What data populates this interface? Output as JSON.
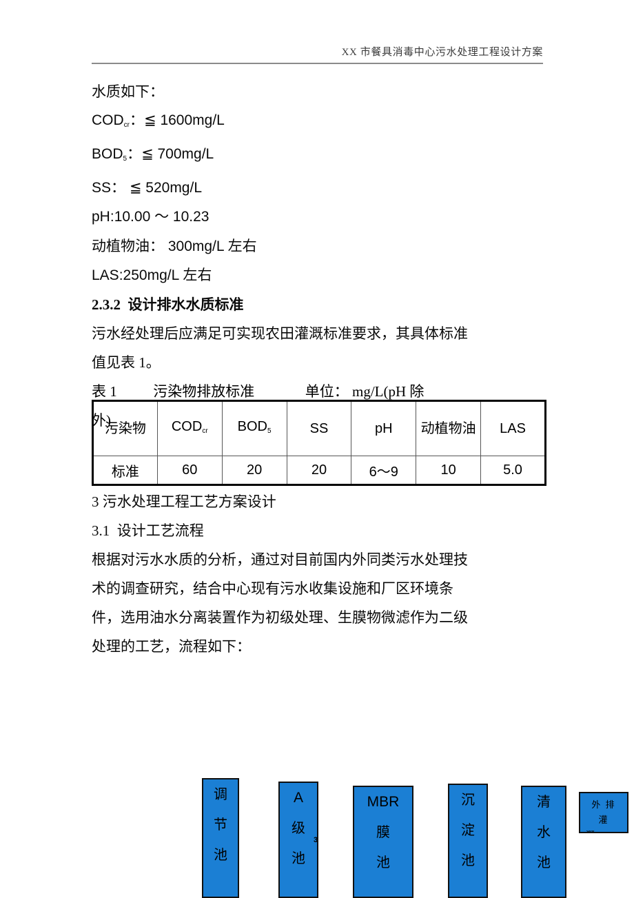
{
  "header": {
    "title": "XX 市餐具消毒中心污水处理工程设计方案"
  },
  "body": {
    "intro_label": "水质如下：",
    "quality": [
      {
        "prefix": "COD",
        "sub": "cr",
        "value": "：≦ 1600mg/L"
      },
      {
        "prefix": "BOD",
        "sub": "5",
        "value": "：≦ 700mg/L"
      },
      {
        "prefix": "SS",
        "sub": "",
        "value": "： ≦ 520mg/L"
      },
      {
        "prefix": "pH",
        "sub": "",
        "value": ":10.00 ～ 10.23"
      },
      {
        "prefix": "动植物油",
        "sub": "",
        "value": "： 300mg/L 左右"
      },
      {
        "prefix": "LAS",
        "sub": "",
        "value": ":250mg/L 左右"
      }
    ],
    "heading_232": "2.3.2  设计排水水质标准",
    "para_232_line1": "污水经处理后应满足可实现农田灌溉标准要求，其具体标准",
    "para_232_line2": "值见表 1。",
    "table_caption_line1": "表 1          污染物排放标准              单位： mg/L(pH 除",
    "table_caption_line2": "外)",
    "heading_3": "3 污水处理工程工艺方案设计",
    "heading_31": "3.1  设计工艺流程",
    "para_31_line1": "根据对污水水质的分析，通过对目前国内外同类污水处理技",
    "para_31_line2": "术的调查研究，结合中心现有污水收集设施和厂区环境条",
    "para_31_line3": "件，选用油水分离装置作为初级处理、生膜物微滤作为二级",
    "para_31_line4": "处理的工艺，流程如下："
  },
  "standards_table": {
    "columns": [
      "污染物",
      "COD",
      "BOD",
      "SS",
      "pH",
      "动植物油",
      "LAS"
    ],
    "row_label": "标准",
    "values": [
      "60",
      "20",
      "20",
      "6～9",
      "10",
      "5.0"
    ]
  },
  "flow_diagram": {
    "boxes": [
      {
        "id": "tiaojie",
        "lines": [
          "调",
          "节",
          "池"
        ],
        "latin": false
      },
      {
        "id": "ajichi",
        "lines": [
          "A",
          "级",
          "池"
        ],
        "latin": true
      },
      {
        "id": "mbr",
        "lines": [
          "MBR",
          "膜",
          "池"
        ],
        "latin": true
      },
      {
        "id": "chending",
        "lines": [
          "沉",
          "淀",
          "池"
        ],
        "latin": false
      },
      {
        "id": "qingshui",
        "lines": [
          "清",
          "水",
          "池"
        ],
        "latin": false
      },
      {
        "id": "waipai",
        "lines": [
          "外 排 灌",
          "溉"
        ],
        "latin": false
      }
    ]
  },
  "page_number": "3",
  "colors": {
    "box_fill": "#1b7fd4",
    "box_border": "#101010",
    "header_rule": "#8a8a8a"
  }
}
